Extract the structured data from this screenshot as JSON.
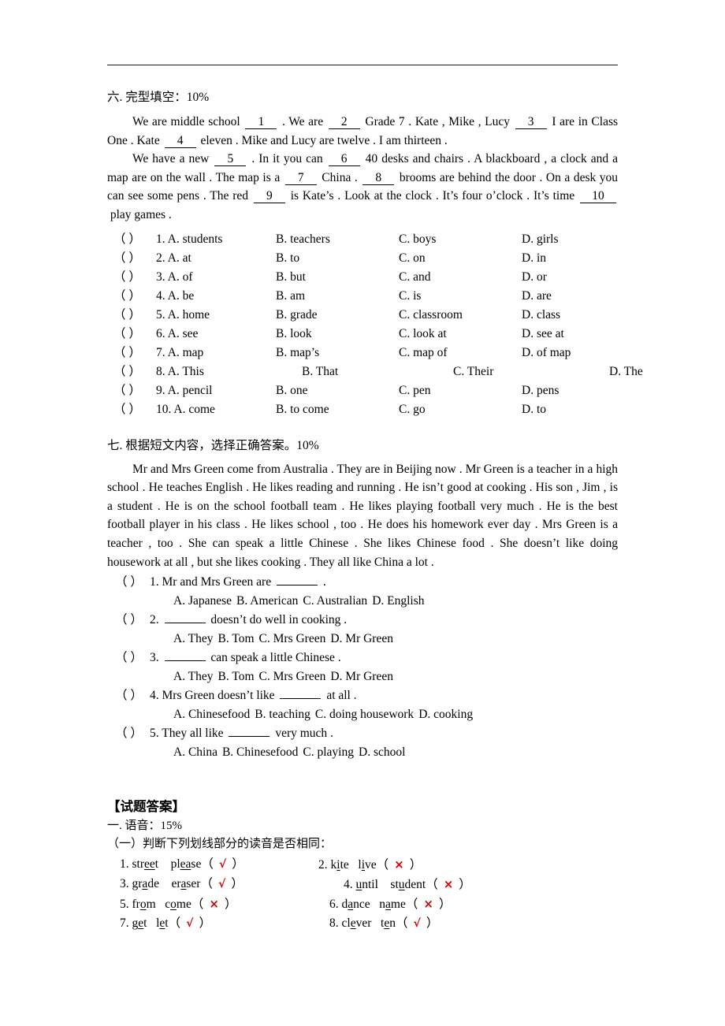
{
  "document": {
    "rule_present": true
  },
  "section6": {
    "heading": "六. 完型填空：10%",
    "passage": {
      "p1_a": "We are middle school",
      "b1": "1",
      "p1_b": ". We are",
      "b2": "2",
      "p1_c": "Grade 7 . Kate , Mike , Lucy",
      "b3": "3",
      "p1_d": "I are in Class One . Kate",
      "b4": "4",
      "p1_e": "eleven . Mike and Lucy are twelve . I am thirteen .",
      "p2_a": "We have a new",
      "b5": "5",
      "p2_b": ". In it you can",
      "b6": "6",
      "p2_c": "40 desks and chairs . A blackboard , a clock and a map are on the wall . The map is a",
      "b7": "7",
      "p2_d": "China .",
      "b8": "8",
      "p2_e": "brooms are behind the door . On a desk you can see some pens . The red",
      "b9": "9",
      "p2_f": "is Kate’s . Look at the clock . It’s four o’clock . It’s time",
      "b10": "10",
      "p2_g": "play games ."
    },
    "options": [
      {
        "paren": "（      ）",
        "num": "1.",
        "a": "A. students",
        "b": "B. teachers",
        "c": "C. boys",
        "d": "D. girls"
      },
      {
        "paren": "（      ）",
        "num": "2.",
        "a": "A. at",
        "b": "B. to",
        "c": "C. on",
        "d": "D. in"
      },
      {
        "paren": "（      ）",
        "num": "3.",
        "a": "A. of",
        "b": "B. but",
        "c": "C. and",
        "d": "D. or"
      },
      {
        "paren": "（      ）",
        "num": "4.",
        "a": "A. be",
        "b": "B. am",
        "c": "C. is",
        "d": "D. are"
      },
      {
        "paren": "（      ）",
        "num": "5.",
        "a": "A. home",
        "b": "B. grade",
        "c": "C. classroom",
        "d": "D. class"
      },
      {
        "paren": "（      ）",
        "num": "6.",
        "a": "A. see",
        "b": "B. look",
        "c": "C. look at",
        "d": "D. see at"
      },
      {
        "paren": "（      ）",
        "num": "7.",
        "a": "A. map",
        "b": "B. map’s",
        "c": "C. map of",
        "d": "D. of map"
      },
      {
        "paren": "（      ）",
        "num": "8.",
        "a": "A. This",
        "b": "B. That",
        "c": "C. Their",
        "d": "D. The"
      },
      {
        "paren": "（      ）",
        "num": "9.",
        "a": "A. pencil",
        "b": "B. one",
        "c": "C. pen",
        "d": "D. pens"
      },
      {
        "paren": "（      ）",
        "num": "10.",
        "a": "A. come",
        "b": "B. to come",
        "c": "C. go",
        "d": "D. to"
      }
    ]
  },
  "section7": {
    "heading": "七. 根据短文内容，选择正确答案。10%",
    "passage": "Mr and Mrs Green come from Australia . They are in Beijing now . Mr Green is a teacher in a high school . He teaches English . He likes reading and running . He isn’t good at cooking . His son , Jim , is a student . He is on the school football team . He likes playing football very much . He is the best football player in his class . He likes school , too . He does his homework ever day . Mrs Green is a teacher , too . She can speak a little Chinese . She likes Chinese food . She doesn’t like doing housework at all , but she likes cooking . They all like China a lot .",
    "questions": [
      {
        "paren": "（      ）",
        "stem_before": "1. Mr and Mrs Green are",
        "stem_after": ".",
        "choices": [
          "A. Japanese",
          "B. American",
          "C. Australian",
          "D. English"
        ]
      },
      {
        "paren": "（      ）",
        "stem_before": "2.",
        "stem_after": "doesn’t do well in cooking .",
        "choices": [
          "A. They",
          "B. Tom",
          "C. Mrs Green",
          "D. Mr Green"
        ]
      },
      {
        "paren": "（      ）",
        "stem_before": "3.",
        "stem_after": "can speak a little Chinese .",
        "choices": [
          "A. They",
          "B. Tom",
          "C. Mrs Green",
          "D. Mr Green"
        ]
      },
      {
        "paren": "（      ）",
        "stem_before": "4. Mrs Green doesn’t like",
        "stem_after": "at all .",
        "choices": [
          "A. Chinesefood",
          "B. teaching",
          "C. doing housework",
          "D. cooking"
        ]
      },
      {
        "paren": "（      ）",
        "stem_before": "5. They all like",
        "stem_after": "very much .",
        "choices": [
          "A. China",
          "B. Chinesefood",
          "C. playing",
          "D. school"
        ]
      }
    ]
  },
  "answers": {
    "title": "【试题答案】",
    "section1_heading": "一. 语音：15%",
    "part1_heading": "（一）判断下列划线部分的读音是否相同：",
    "mark_color": "#e00000",
    "items": [
      {
        "num": "1.",
        "w1_pre": "str",
        "w1_u": "ee",
        "w1_post": "t",
        "w2_pre": "pl",
        "w2_u": "ea",
        "w2_post": "se",
        "mark": "√"
      },
      {
        "num": "2.",
        "w1_pre": "k",
        "w1_u": "i",
        "w1_post": "te",
        "w2_pre": "l",
        "w2_u": "i",
        "w2_post": "ve",
        "mark": "×"
      },
      {
        "num": "3.",
        "w1_pre": "gr",
        "w1_u": "a",
        "w1_post": "de",
        "w2_pre": "er",
        "w2_u": "a",
        "w2_post": "ser",
        "mark": "√"
      },
      {
        "num": "4.",
        "w1_pre": "",
        "w1_u": "u",
        "w1_post": "ntil",
        "w2_pre": "st",
        "w2_u": "u",
        "w2_post": "dent",
        "mark": "×"
      },
      {
        "num": "5.",
        "w1_pre": "fr",
        "w1_u": "o",
        "w1_post": "m",
        "w2_pre": "c",
        "w2_u": "o",
        "w2_post": "me",
        "mark": "×"
      },
      {
        "num": "6.",
        "w1_pre": "d",
        "w1_u": "a",
        "w1_post": "nce",
        "w2_pre": "n",
        "w2_u": "a",
        "w2_post": "me",
        "mark": "×"
      },
      {
        "num": "7.",
        "w1_pre": "g",
        "w1_u": "e",
        "w1_post": "t",
        "w2_pre": "l",
        "w2_u": "e",
        "w2_post": "t",
        "mark": "√"
      },
      {
        "num": "8.",
        "w1_pre": "cl",
        "w1_u": "e",
        "w1_post": "ver",
        "w2_pre": "t",
        "w2_u": "e",
        "w2_post": "n",
        "mark": "√"
      }
    ]
  }
}
